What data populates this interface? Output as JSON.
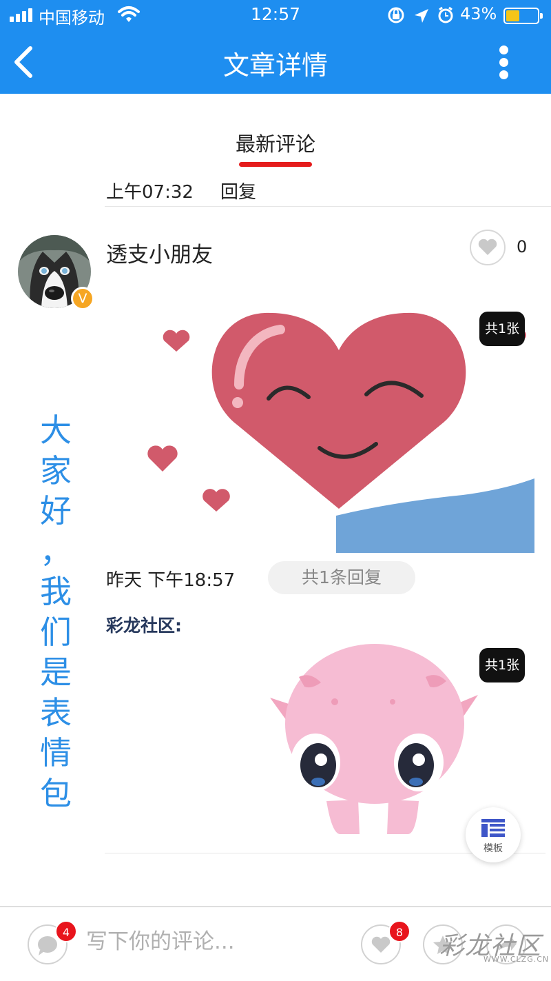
{
  "status_bar": {
    "carrier": "中国移动",
    "time": "12:57",
    "battery_percent": "43%",
    "battery_level": 0.43
  },
  "nav": {
    "title": "文章详情",
    "back_icon": "chevron-left-icon",
    "more_icon": "more-vertical-icon"
  },
  "tabs": {
    "active_label": "最新评论",
    "underline_color": "#e51c1c"
  },
  "previous_comment": {
    "time": "上午07:32",
    "reply_label": "回复"
  },
  "comment": {
    "username": "透支小朋友",
    "verified_badge": "V",
    "like_count": "0",
    "image_count_label": "共1张",
    "time": "昨天 下午18:57",
    "reply_count_label": "共1条回复"
  },
  "side_text": {
    "chars": [
      "大",
      "家",
      "好",
      "，",
      "我",
      "们",
      "是",
      "表",
      "情",
      "包"
    ],
    "color": "#2d8fe6"
  },
  "reply": {
    "author": "彩龙社区:",
    "image_count_label": "共1张"
  },
  "template_button": {
    "label": "模板"
  },
  "bottom_bar": {
    "comment_badge": "4",
    "input_placeholder": "写下你的评论...",
    "like_badge": "8"
  },
  "watermark": {
    "title": "彩龙社区",
    "url": "WWW.CLZG.CN"
  },
  "colors": {
    "brand_blue": "#1e8ef0",
    "badge_red": "#e8141c",
    "verified_orange": "#f6a623"
  }
}
